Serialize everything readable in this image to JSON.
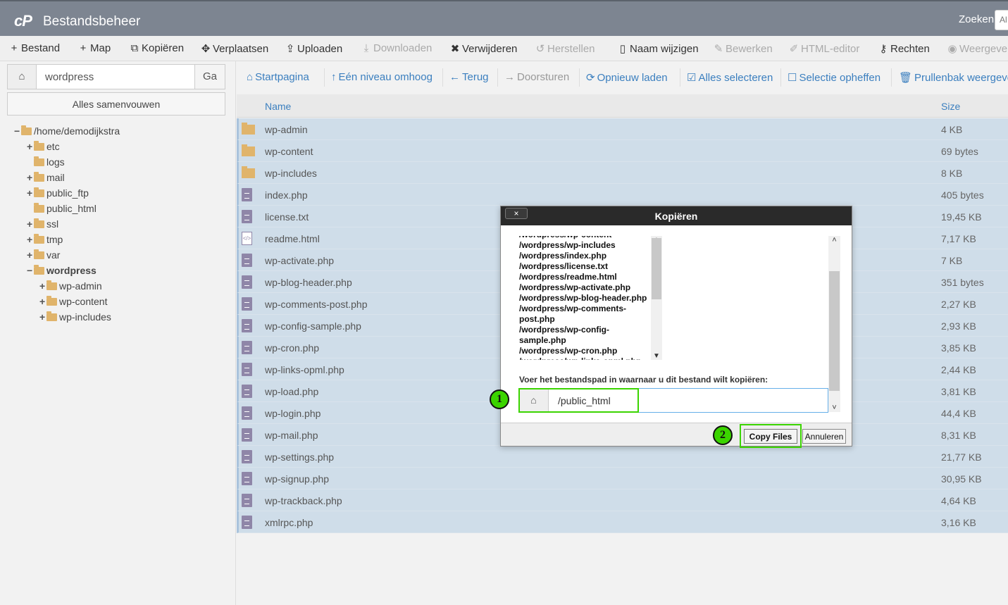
{
  "header": {
    "logo": "cP",
    "title": "Bestandsbeheer",
    "search_label": "Zoeken",
    "search_value": "Al"
  },
  "toolbar": [
    {
      "label": "Bestand",
      "icon": "+",
      "icon_name": "plus-icon",
      "enabled": true
    },
    {
      "label": "Map",
      "icon": "+",
      "icon_name": "plus-icon",
      "enabled": true
    },
    {
      "label": "Kopiëren",
      "icon": "⧉",
      "icon_name": "copy-icon",
      "enabled": true
    },
    {
      "label": "Verplaatsen",
      "icon": "✥",
      "icon_name": "move-icon",
      "enabled": true
    },
    {
      "label": "Uploaden",
      "icon": "⇪",
      "icon_name": "upload-icon",
      "enabled": true
    },
    {
      "label": "Downloaden",
      "icon": "⤓",
      "icon_name": "download-icon",
      "enabled": false
    },
    {
      "label": "Verwijderen",
      "icon": "✖",
      "icon_name": "delete-icon",
      "enabled": true
    },
    {
      "label": "Herstellen",
      "icon": "↺",
      "icon_name": "restore-icon",
      "enabled": false
    },
    {
      "label": "Naam wijzigen",
      "icon": "▯",
      "icon_name": "rename-icon",
      "enabled": true
    },
    {
      "label": "Bewerken",
      "icon": "✎",
      "icon_name": "edit-icon",
      "enabled": false
    },
    {
      "label": "HTML-editor",
      "icon": "✐",
      "icon_name": "html-editor-icon",
      "enabled": false
    },
    {
      "label": "Rechten",
      "icon": "⚷",
      "icon_name": "key-icon",
      "enabled": true
    },
    {
      "label": "Weergeven",
      "icon": "◉",
      "icon_name": "eye-icon",
      "enabled": false
    }
  ],
  "sidebar": {
    "path_value": "wordpress",
    "go_label": "Ga",
    "collapse_label": "Alles samenvouwen",
    "tree": [
      {
        "label": "/home/demodijkstra",
        "sign": "−",
        "bold": false
      },
      {
        "label": "etc",
        "sign": "+",
        "bold": false
      },
      {
        "label": "logs",
        "sign": "",
        "bold": false
      },
      {
        "label": "mail",
        "sign": "+",
        "bold": false
      },
      {
        "label": "public_ftp",
        "sign": "+",
        "bold": false
      },
      {
        "label": "public_html",
        "sign": "",
        "bold": false
      },
      {
        "label": "ssl",
        "sign": "+",
        "bold": false
      },
      {
        "label": "tmp",
        "sign": "+",
        "bold": false
      },
      {
        "label": "var",
        "sign": "+",
        "bold": false
      },
      {
        "label": "wordpress",
        "sign": "−",
        "bold": true
      },
      {
        "label": "wp-admin",
        "sign": "+",
        "bold": false
      },
      {
        "label": "wp-content",
        "sign": "+",
        "bold": false
      },
      {
        "label": "wp-includes",
        "sign": "+",
        "bold": false
      }
    ]
  },
  "nav": [
    {
      "label": "Startpagina",
      "icon": "⌂",
      "icon_name": "home-icon",
      "enabled": true
    },
    {
      "label": "Eén niveau omhoog",
      "icon": "↑",
      "icon_name": "up-level-icon",
      "enabled": true
    },
    {
      "label": "Terug",
      "icon": "←",
      "icon_name": "back-icon",
      "enabled": true
    },
    {
      "label": "Doorsturen",
      "icon": "→",
      "icon_name": "forward-icon",
      "enabled": false
    },
    {
      "label": "Opnieuw laden",
      "icon": "⟳",
      "icon_name": "reload-icon",
      "enabled": true
    },
    {
      "label": "Alles selecteren",
      "icon": "☑",
      "icon_name": "select-all-icon",
      "enabled": true
    },
    {
      "label": "Selectie opheffen",
      "icon": "☐",
      "icon_name": "deselect-icon",
      "enabled": true
    },
    {
      "label": "Prullenbak weergeven",
      "icon": "🗑",
      "icon_name": "trash-icon",
      "enabled": true
    }
  ],
  "table": {
    "columns": {
      "name": "Name",
      "size": "Size"
    },
    "rows": [
      {
        "name": "wp-admin",
        "size": "4 KB",
        "type": "folder"
      },
      {
        "name": "wp-content",
        "size": "69 bytes",
        "type": "folder"
      },
      {
        "name": "wp-includes",
        "size": "8 KB",
        "type": "folder"
      },
      {
        "name": "index.php",
        "size": "405 bytes",
        "type": "file"
      },
      {
        "name": "license.txt",
        "size": "19,45 KB",
        "type": "file"
      },
      {
        "name": "readme.html",
        "size": "7,17 KB",
        "type": "html"
      },
      {
        "name": "wp-activate.php",
        "size": "7 KB",
        "type": "file"
      },
      {
        "name": "wp-blog-header.php",
        "size": "351 bytes",
        "type": "file"
      },
      {
        "name": "wp-comments-post.php",
        "size": "2,27 KB",
        "type": "file"
      },
      {
        "name": "wp-config-sample.php",
        "size": "2,93 KB",
        "type": "file"
      },
      {
        "name": "wp-cron.php",
        "size": "3,85 KB",
        "type": "file"
      },
      {
        "name": "wp-links-opml.php",
        "size": "2,44 KB",
        "type": "file"
      },
      {
        "name": "wp-load.php",
        "size": "3,81 KB",
        "type": "file"
      },
      {
        "name": "wp-login.php",
        "size": "44,4 KB",
        "type": "file"
      },
      {
        "name": "wp-mail.php",
        "size": "8,31 KB",
        "type": "file"
      },
      {
        "name": "wp-settings.php",
        "size": "21,77 KB",
        "type": "file"
      },
      {
        "name": "wp-signup.php",
        "size": "30,95 KB",
        "type": "file"
      },
      {
        "name": "wp-trackback.php",
        "size": "4,64 KB",
        "type": "file"
      },
      {
        "name": "xmlrpc.php",
        "size": "3,16 KB",
        "type": "file"
      }
    ]
  },
  "modal": {
    "title": "Kopiëren",
    "close_label": "×",
    "file_list": [
      "/wordpress/wp-content",
      "/wordpress/wp-includes",
      "/wordpress/index.php",
      "/wordpress/license.txt",
      "/wordpress/readme.html",
      "/wordpress/wp-activate.php",
      "/wordpress/wp-blog-header.php",
      "/wordpress/wp-comments-post.php",
      "/wordpress/wp-config-sample.php",
      "/wordpress/wp-cron.php",
      "/wordpress/wp-links-opml.php"
    ],
    "dest_label": "Voer het bestandspad in waarnaar u dit bestand wilt kopiëren:",
    "dest_value": "/public_html",
    "copy_label": "Copy Files",
    "cancel_label": "Annuleren"
  },
  "annotations": {
    "marker1": "1",
    "marker2": "2",
    "highlight_color": "#3bd400"
  }
}
